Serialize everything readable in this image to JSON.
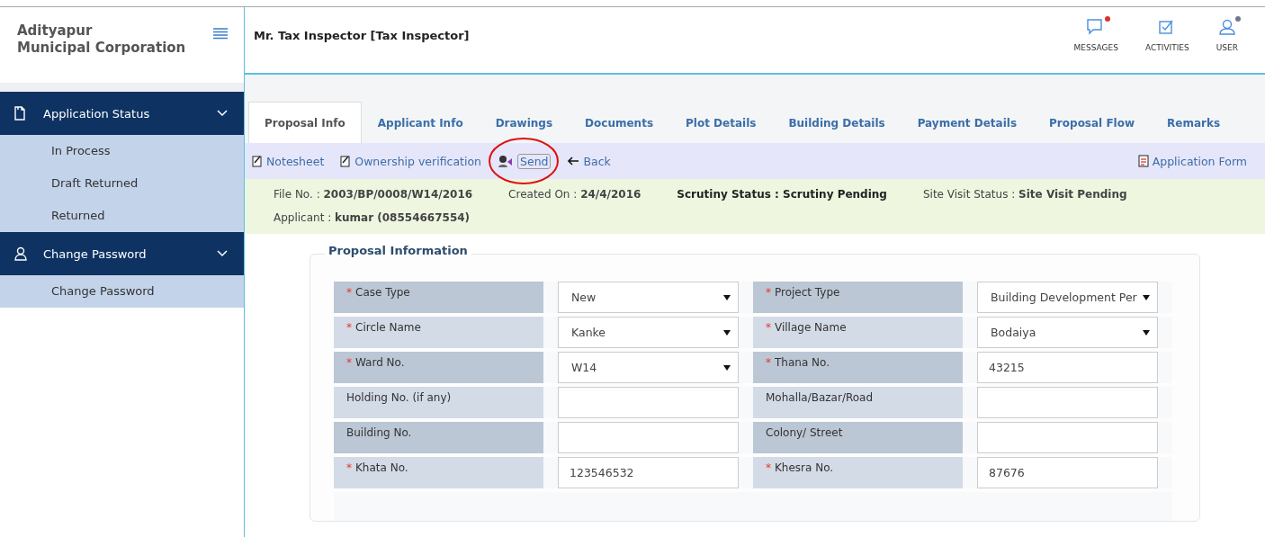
{
  "brand": {
    "line1": "Adityapur",
    "line2": "Municipal Corporation"
  },
  "header": {
    "user": "Mr. Tax Inspector [Tax Inspector]",
    "actions": [
      {
        "kind": "messages",
        "label": "MESSAGES",
        "color": "#d9342b"
      },
      {
        "kind": "activities",
        "label": "ACTIVITIES"
      },
      {
        "kind": "user",
        "label": "USER",
        "color": "#6b7b8c"
      }
    ]
  },
  "sidebar": [
    {
      "kind": "doc",
      "title": "Application Status",
      "expanded": true,
      "items": [
        "In Process",
        "Draft Returned",
        "Returned"
      ]
    },
    {
      "kind": "person",
      "title": "Change Password",
      "expanded": true,
      "items": [
        "Change Password"
      ]
    }
  ],
  "tabs": [
    {
      "label": "Proposal Info",
      "selected": true
    },
    {
      "label": "Applicant Info",
      "selected": false
    },
    {
      "label": "Drawings",
      "selected": false
    },
    {
      "label": "Documents",
      "selected": false
    },
    {
      "label": "Plot Details",
      "selected": false
    },
    {
      "label": "Building Details",
      "selected": false
    },
    {
      "label": "Payment Details",
      "selected": false
    },
    {
      "label": "Proposal Flow",
      "selected": false
    },
    {
      "label": "Remarks",
      "selected": false
    }
  ],
  "toolbar": {
    "links": [
      {
        "kind": "note",
        "label": "Notesheet"
      },
      {
        "kind": "note",
        "label": "Ownership verification"
      },
      {
        "kind": "send",
        "label": "Send",
        "circled": true
      },
      {
        "kind": "back",
        "label": "Back"
      }
    ],
    "right": "Application Form"
  },
  "info": [
    [
      {
        "text": "File No. : **2003/BP/0008/W14/2016**",
        "bold": false
      },
      {
        "text": "Created On : **24/4/2016**",
        "bold": false
      },
      {
        "text": "Scrutiny Status : Scrutiny Pending",
        "bold": true
      },
      {
        "text": "Site Visit Status : **Site Visit Pending**",
        "bold": false
      }
    ],
    [
      {
        "text": "Applicant : **kumar (08554667554)**",
        "bold": false
      }
    ]
  ],
  "form": {
    "legend": "Proposal Information",
    "rows": [
      [
        {
          "mark": "*",
          "label": "Case Type",
          "kind": "select",
          "value": "New"
        },
        {
          "mark": "*",
          "label": "Project Type",
          "kind": "select",
          "value": "Building Development Per"
        }
      ],
      [
        {
          "mark": "*",
          "label": "Circle Name",
          "kind": "select",
          "value": "Kanke"
        },
        {
          "mark": "*",
          "label": "Village Name",
          "kind": "select",
          "value": "Bodaiya"
        }
      ],
      [
        {
          "mark": "*",
          "label": "Ward No.",
          "kind": "select",
          "value": "W14"
        },
        {
          "mark": "*",
          "label": "Thana No.",
          "kind": "text",
          "value": "43215"
        }
      ],
      [
        {
          "label": "Holding No. (if any)",
          "kind": "text"
        },
        {
          "label": "Mohalla/Bazar/Road",
          "kind": "text"
        }
      ],
      [
        {
          "label": "Building No.",
          "kind": "text"
        },
        {
          "label": "Colony/ Street",
          "kind": "text"
        }
      ],
      [
        {
          "mark": "*",
          "label": "Khata No.",
          "kind": "text",
          "value": "123546532"
        },
        {
          "mark": "*",
          "label": "Khesra No.",
          "kind": "text",
          "value": "87676"
        }
      ]
    ]
  }
}
